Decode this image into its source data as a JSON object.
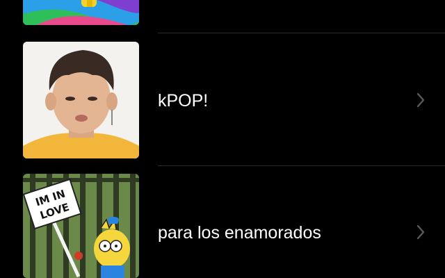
{
  "colors": {
    "background": "#000000",
    "text": "#ffffff",
    "chevron": "#5a5a5e",
    "separator": "#2b2b2d"
  },
  "list": {
    "items": [
      {
        "title": "",
        "thumbnail": "colorful-cartoon-partial"
      },
      {
        "title": "kPOP!",
        "thumbnail": "person-photo"
      },
      {
        "title": "para los enamorados",
        "thumbnail": "cartoon-sign",
        "sign_text": "IM IN LOVE"
      }
    ]
  }
}
